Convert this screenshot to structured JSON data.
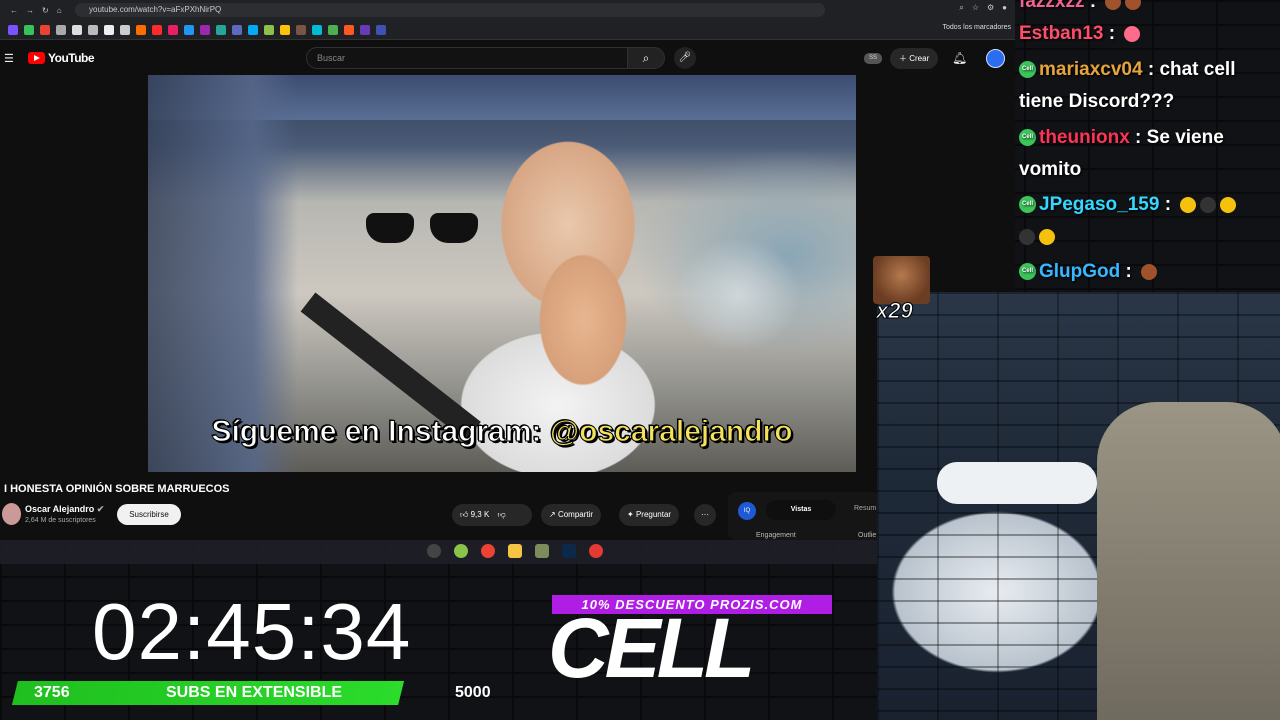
{
  "browser": {
    "url": "youtube.com/watch?v=aFxPXhNirPQ",
    "bookmarks_folder": "Todos los marcadores"
  },
  "youtube": {
    "logo": "YouTube",
    "search_placeholder": "Buscar",
    "ss_badge": "SS",
    "create_label": "Crear",
    "video": {
      "subtitle_prefix": "Sígueme en Instagram: ",
      "subtitle_handle": "@oscaralejandro",
      "title": "I HONESTA OPINIÓN SOBRE MARRUECOS",
      "channel_name": "Oscar Alejandro",
      "subscribers": "2,64 M de suscriptores",
      "subscribe_label": "Suscribirse",
      "likes": "9,3 K",
      "share_label": "Compartir",
      "ask_label": "Preguntar",
      "more_label": "···"
    },
    "side_panel": {
      "icon_text": "IQ",
      "tab_active": "Vistas",
      "tab_other": "Resum",
      "label_left": "Engagement",
      "label_right": "Outlie"
    }
  },
  "overlay": {
    "timer": "02:45:34",
    "goal_current": "3756",
    "goal_label": "SUBS EN EXTENSIBLE",
    "goal_max": "5000",
    "goal_progress": 0.7512,
    "promo": "10% DESCUENTO PROZIS.COM",
    "brand": "CELL",
    "emote_count": "x29"
  },
  "chat": {
    "messages": [
      {
        "user": "fazzxzz",
        "user_color": "#f06292",
        "text": ""
      },
      {
        "user": "Estban13",
        "user_color": "#ff4d6a",
        "text": ""
      },
      {
        "user": "mariaxcv04",
        "user_color": "#e6a43c",
        "text": "chat cell"
      },
      {
        "user": "",
        "user_color": "#ffffff",
        "text": "tiene Discord???"
      },
      {
        "user": "theunionx",
        "user_color": "#ff3355",
        "text": "Se viene"
      },
      {
        "user": "",
        "user_color": "#ffffff",
        "text": "vomito"
      },
      {
        "user": "JPegaso_159",
        "user_color": "#33d7ff",
        "text": ""
      },
      {
        "user": "GlupGod",
        "user_color": "#38b6ff",
        "text": ""
      }
    ],
    "badge_text": "Cell"
  }
}
